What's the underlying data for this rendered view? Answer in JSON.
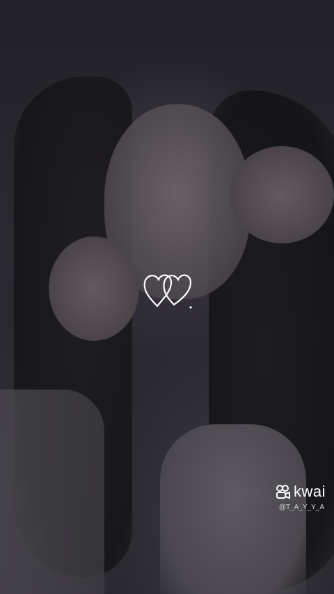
{
  "watermark": {
    "brand": "kwai",
    "username": "@T_A_Y_Y_A",
    "logo_icon": "kwai-logo-icon"
  },
  "overlay": {
    "icon": "interlocked-hearts-icon",
    "color": "#ffffff"
  },
  "background": {
    "tint": "#26252b"
  }
}
